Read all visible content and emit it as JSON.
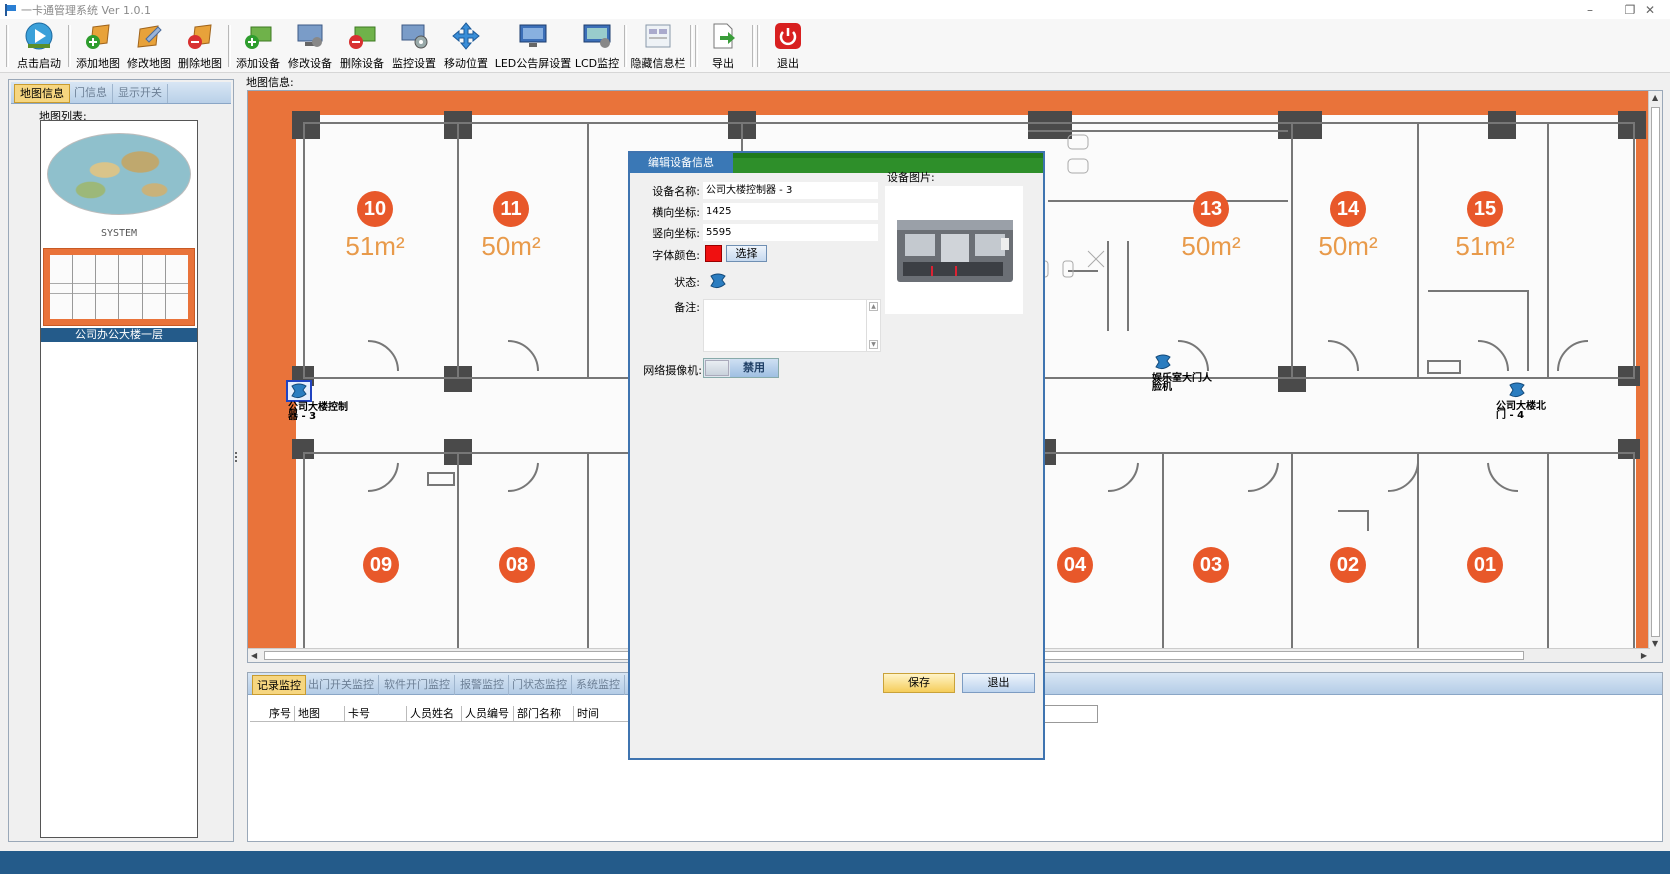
{
  "window": {
    "title": "一卡通管理系统  Ver 1.0.1",
    "minimize": "–",
    "restore": "❐",
    "close": "✕"
  },
  "toolbar": {
    "buttons": [
      {
        "label": "点击启动",
        "icon": "start-icon"
      },
      {
        "label": "添加地图",
        "icon": "add-map-icon"
      },
      {
        "label": "修改地图",
        "icon": "edit-map-icon"
      },
      {
        "label": "删除地图",
        "icon": "delete-map-icon"
      },
      {
        "label": "添加设备",
        "icon": "add-device-icon"
      },
      {
        "label": "修改设备",
        "icon": "edit-device-icon"
      },
      {
        "label": "删除设备",
        "icon": "delete-device-icon"
      },
      {
        "label": "监控设置",
        "icon": "monitor-settings-icon"
      },
      {
        "label": "移动位置",
        "icon": "move-icon"
      },
      {
        "label": "LED公告屏设置",
        "icon": "led-icon"
      },
      {
        "label": "LCD监控",
        "icon": "lcd-icon"
      },
      {
        "label": "隐藏信息栏",
        "icon": "hide-panel-icon"
      },
      {
        "label": "导出",
        "icon": "export-icon"
      },
      {
        "label": "退出",
        "icon": "power-icon"
      }
    ]
  },
  "left_panel": {
    "tabs": [
      "地图信息",
      "门信息",
      "显示开关"
    ],
    "map_list_label": "地图列表:",
    "maps": [
      {
        "caption": "SYSTEM"
      },
      {
        "caption": "公司办公大楼一层"
      }
    ]
  },
  "map": {
    "label": "地图信息:",
    "rooms": [
      {
        "num": "10",
        "area": "51m²"
      },
      {
        "num": "11",
        "area": "50m²"
      },
      {
        "num": "13",
        "area": "50m²"
      },
      {
        "num": "14",
        "area": "50m²"
      },
      {
        "num": "15",
        "area": "51m²"
      },
      {
        "num": "09",
        "area": ""
      },
      {
        "num": "08",
        "area": ""
      },
      {
        "num": "04",
        "area": ""
      },
      {
        "num": "03",
        "area": ""
      },
      {
        "num": "02",
        "area": ""
      },
      {
        "num": "01",
        "area": ""
      }
    ],
    "devices": [
      {
        "label": "公司大楼控制器 - 3"
      },
      {
        "label": "娱乐室大门人脸机"
      },
      {
        "label": "公司大楼北门 - 4"
      }
    ]
  },
  "bottom": {
    "tabs": [
      "记录监控",
      "出门开关监控",
      "软件开门监控",
      "报警监控",
      "门状态监控",
      "系统监控"
    ],
    "columns": [
      "序号",
      "地图",
      "卡号",
      "人员姓名",
      "人员编号",
      "部门名称",
      "时间"
    ]
  },
  "dialog": {
    "title": "编辑设备信息",
    "device_name_label": "设备名称:",
    "device_name": "公司大楼控制器 - 3",
    "x_label": "横向坐标:",
    "x_value": "1425",
    "y_label": "竖向坐标:",
    "y_value": "5595",
    "font_color_label": "字体颜色:",
    "font_color": "#f01010",
    "choose_label": "选择",
    "status_label": "状态:",
    "remarks_label": "备注:",
    "remarks": "",
    "camera_label": "网络摄像机:",
    "camera_state": "禁用",
    "image_label": "设备图片:",
    "save_label": "保存",
    "exit_label": "退出"
  },
  "colors": {
    "accent_blue": "#245b8a",
    "map_orange": "#e9733a",
    "room_badge": "#e8582a",
    "active_tab": "#f6d680"
  }
}
